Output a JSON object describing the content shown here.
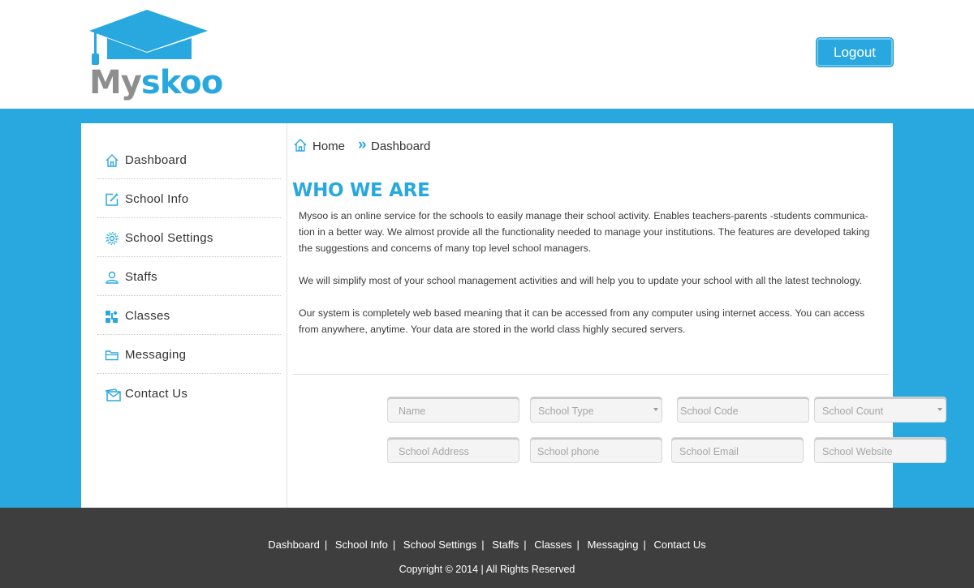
{
  "brand": {
    "name_part1": "My",
    "name_part2": "skoo",
    "primary_color": "#29a8e0",
    "secondary_color": "#8e8e8e"
  },
  "header": {
    "logout_label": "Logout"
  },
  "sidebar": {
    "items": [
      {
        "label": "Dashboard",
        "icon": "home-icon"
      },
      {
        "label": "School Info",
        "icon": "edit-icon"
      },
      {
        "label": "School Settings",
        "icon": "gear-icon"
      },
      {
        "label": "Staffs",
        "icon": "user-icon"
      },
      {
        "label": "Classes",
        "icon": "classes-icon"
      },
      {
        "label": "Messaging",
        "icon": "folder-icon"
      },
      {
        "label": "Contact Us",
        "icon": "mail-icon"
      }
    ]
  },
  "breadcrumb": {
    "home": "Home",
    "separator": "»",
    "current": "Dashboard"
  },
  "about": {
    "title": "WHO WE ARE",
    "p1_l1": "Mysoo is an online service for the schools to easily manage their school activity. Enables teachers-parents -students communica-",
    "p1_l2": "tion in a better way. We almost provide all the functionality needed to manage your institutions. The features are developed taking",
    "p1_l3": "the suggestions and concerns of many top level school managers.",
    "p2": "We will simplify most of your school management activities and will help you to update your school with all the latest technology.",
    "p3_l1": "Our system is completely web based meaning that it can be accessed from any computer using internet access. You can access",
    "p3_l2": "from anywhere, anytime. Your data are stored in the world class highly secured servers."
  },
  "form": {
    "name": "Name",
    "school_type": "School Type",
    "school_code": "School Code",
    "school_count": "School Count",
    "school_address": "School Address",
    "school_phone": "School phone",
    "school_email": "School Email",
    "school_website": "School Website"
  },
  "footer": {
    "links": [
      "Dashboard",
      "School Info",
      "School Settings",
      "Staffs",
      "Classes",
      "Messaging",
      "Contact Us"
    ],
    "separator": "|",
    "copyright": "Copyright © 2014 | All Rights Reserved"
  }
}
